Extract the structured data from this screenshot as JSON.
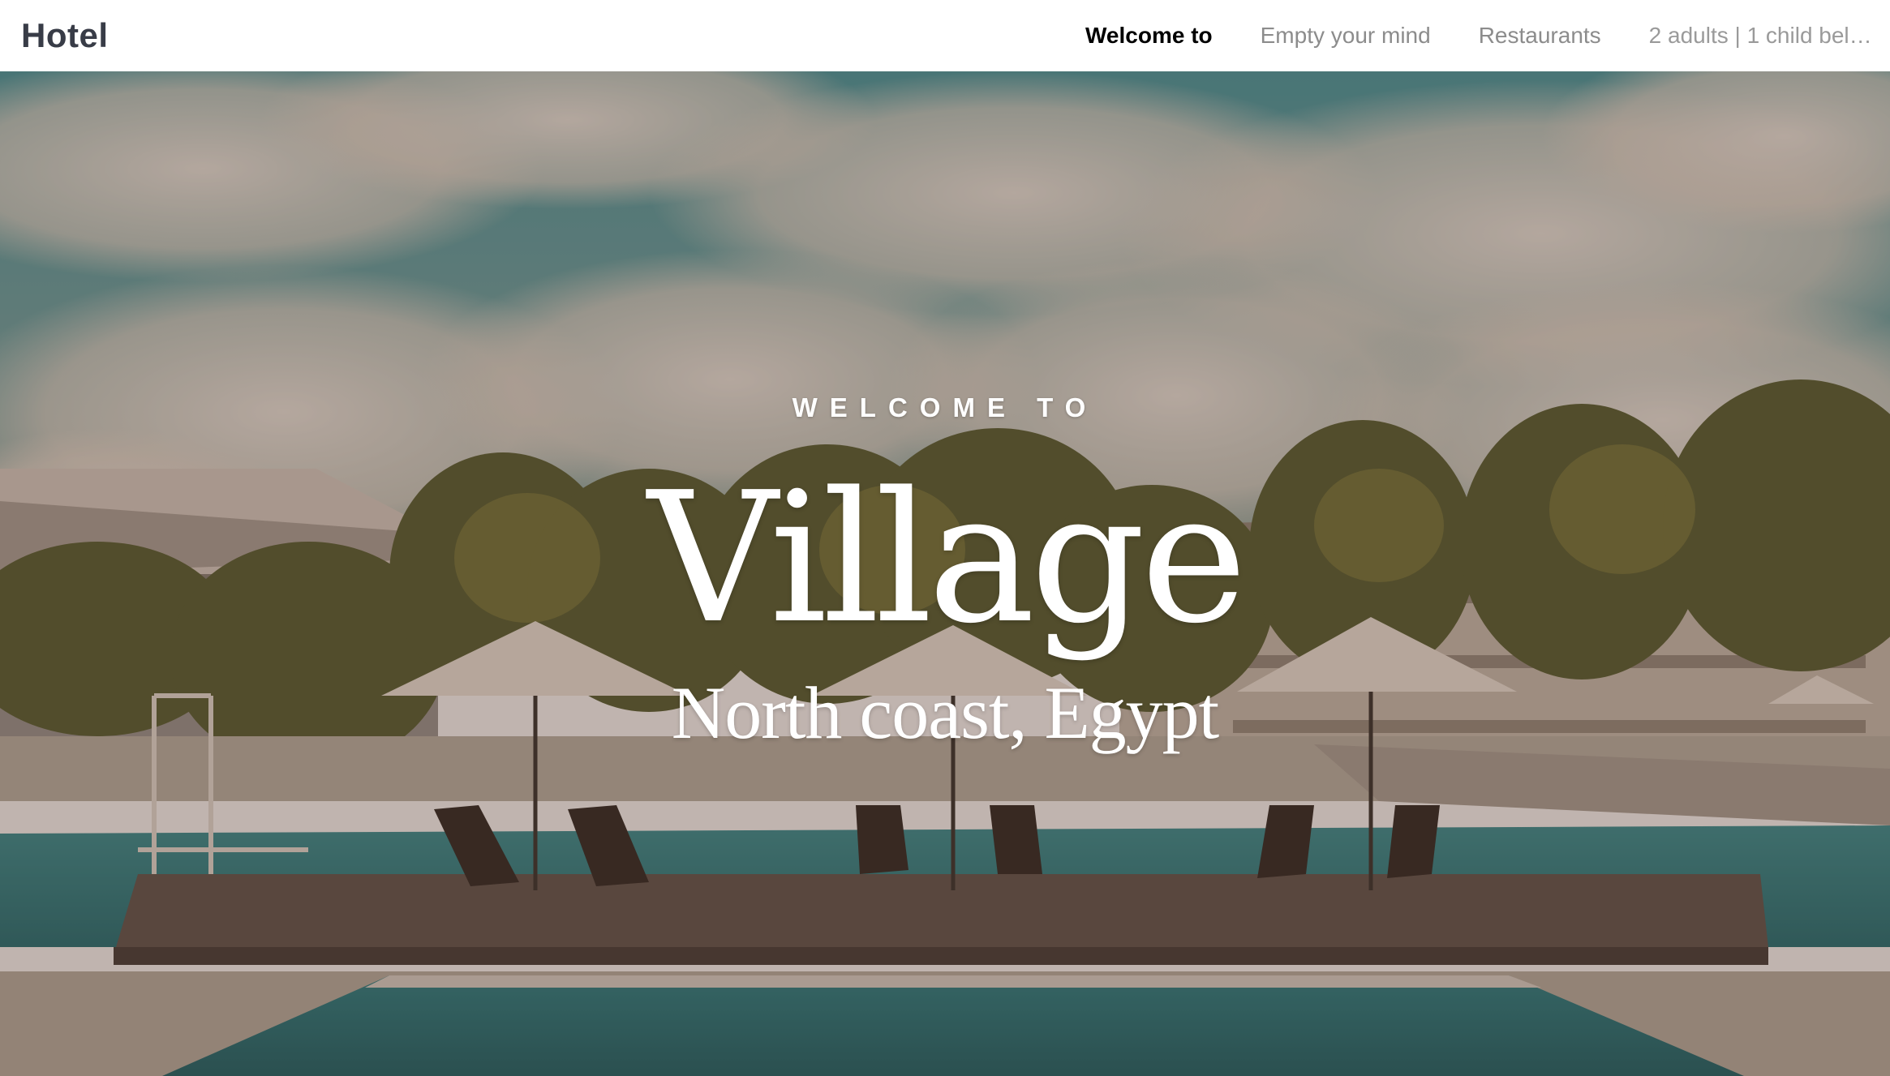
{
  "navbar": {
    "brand": "Hotel",
    "links": [
      {
        "label": "Welcome to",
        "active": true
      },
      {
        "label": "Empty your mind",
        "active": false
      },
      {
        "label": "Restaurants",
        "active": false
      },
      {
        "label": "2 adults | 1 child bel…",
        "active": false
      }
    ]
  },
  "hero": {
    "eyebrow": "WELCOME TO",
    "title": "Village",
    "subtitle": "North coast, Egypt",
    "image_description_icon": "resort-pool-photo",
    "overlay_color": "#5a3a2c"
  },
  "colors": {
    "brand_text": "#383c47",
    "nav_active": "#000000",
    "nav_inactive": "#8c8c8c",
    "hero_text": "#ffffff",
    "sky_blue": "#2e8a94",
    "pool_teal": "#1f7a80"
  }
}
